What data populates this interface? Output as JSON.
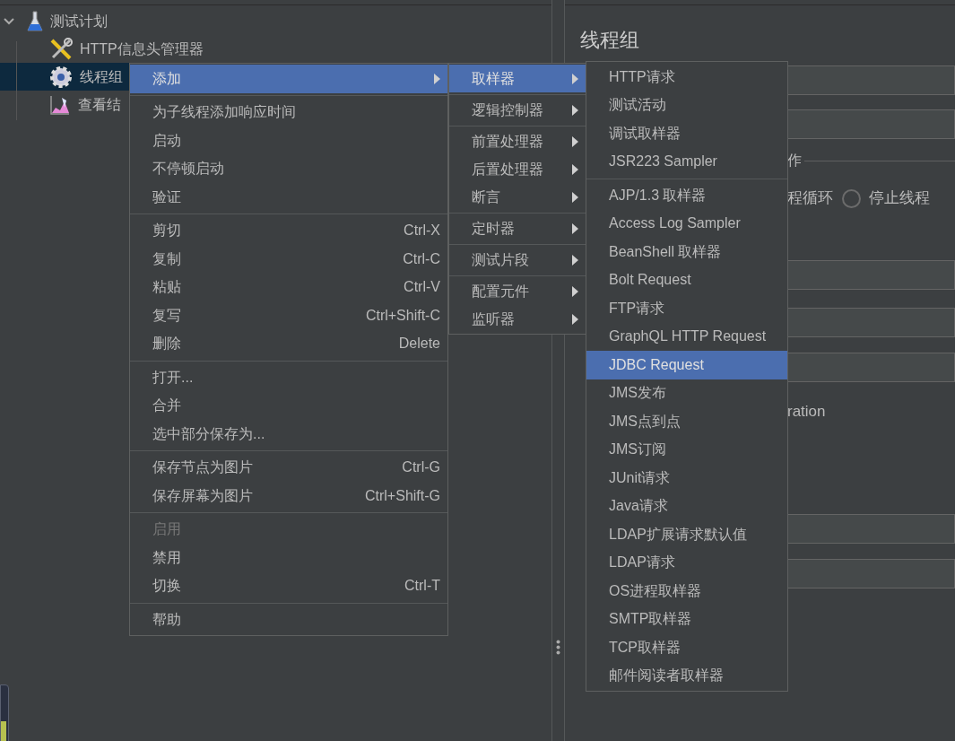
{
  "tree": {
    "label": "测试计划",
    "expanded": true,
    "children": [
      {
        "label": "HTTP信息头管理器",
        "selected": false,
        "kind": "config"
      },
      {
        "label": "线程组",
        "selected": true,
        "kind": "threads"
      },
      {
        "label": "查看结",
        "selected": false,
        "kind": "listener"
      }
    ]
  },
  "right_panel": {
    "title": "线程组",
    "group_label": "作",
    "options": [
      {
        "label": "程循环"
      },
      {
        "label": "停止线程",
        "selected": false
      }
    ],
    "text_1": "ration"
  },
  "context_menu": {
    "items": [
      {
        "kind": "item",
        "label": "添加",
        "submenu": true,
        "selected": true,
        "disabled": false
      },
      {
        "kind": "separator"
      },
      {
        "kind": "item",
        "label": "为子线程添加响应时间",
        "selected": false,
        "disabled": false
      },
      {
        "kind": "item",
        "label": "启动",
        "selected": false,
        "disabled": false
      },
      {
        "kind": "item",
        "label": "不停顿启动",
        "selected": false,
        "disabled": false
      },
      {
        "kind": "item",
        "label": "验证",
        "selected": false,
        "disabled": false
      },
      {
        "kind": "separator"
      },
      {
        "kind": "item",
        "label": "剪切",
        "shortcut": "Ctrl-X",
        "selected": false,
        "disabled": false
      },
      {
        "kind": "item",
        "label": "复制",
        "shortcut": "Ctrl-C",
        "selected": false,
        "disabled": false
      },
      {
        "kind": "item",
        "label": "粘贴",
        "shortcut": "Ctrl-V",
        "selected": false,
        "disabled": false
      },
      {
        "kind": "item",
        "label": "复写",
        "shortcut": "Ctrl+Shift-C",
        "selected": false,
        "disabled": false
      },
      {
        "kind": "item",
        "label": "删除",
        "shortcut": "Delete",
        "selected": false,
        "disabled": false
      },
      {
        "kind": "separator"
      },
      {
        "kind": "item",
        "label": "打开...",
        "selected": false,
        "disabled": false
      },
      {
        "kind": "item",
        "label": "合并",
        "selected": false,
        "disabled": false
      },
      {
        "kind": "item",
        "label": "选中部分保存为...",
        "selected": false,
        "disabled": false
      },
      {
        "kind": "separator"
      },
      {
        "kind": "item",
        "label": "保存节点为图片",
        "shortcut": "Ctrl-G",
        "selected": false,
        "disabled": false
      },
      {
        "kind": "item",
        "label": "保存屏幕为图片",
        "shortcut": "Ctrl+Shift-G",
        "selected": false,
        "disabled": false
      },
      {
        "kind": "separator"
      },
      {
        "kind": "item",
        "label": "启用",
        "selected": false,
        "disabled": true
      },
      {
        "kind": "item",
        "label": "禁用",
        "selected": false,
        "disabled": false
      },
      {
        "kind": "item",
        "label": "切换",
        "shortcut": "Ctrl-T",
        "selected": false,
        "disabled": false
      },
      {
        "kind": "separator"
      },
      {
        "kind": "item",
        "label": "帮助",
        "selected": false,
        "disabled": false
      }
    ]
  },
  "add_submenu": {
    "items": [
      {
        "kind": "item",
        "label": "取样器",
        "submenu": true,
        "selected": true,
        "disabled": false
      },
      {
        "kind": "separator"
      },
      {
        "kind": "item",
        "label": "逻辑控制器",
        "submenu": true,
        "selected": false,
        "disabled": false
      },
      {
        "kind": "separator"
      },
      {
        "kind": "item",
        "label": "前置处理器",
        "submenu": true,
        "selected": false,
        "disabled": false
      },
      {
        "kind": "item",
        "label": "后置处理器",
        "submenu": true,
        "selected": false,
        "disabled": false
      },
      {
        "kind": "item",
        "label": "断言",
        "submenu": true,
        "selected": false,
        "disabled": false
      },
      {
        "kind": "separator"
      },
      {
        "kind": "item",
        "label": "定时器",
        "submenu": true,
        "selected": false,
        "disabled": false
      },
      {
        "kind": "separator"
      },
      {
        "kind": "item",
        "label": "测试片段",
        "submenu": true,
        "selected": false,
        "disabled": false
      },
      {
        "kind": "separator"
      },
      {
        "kind": "item",
        "label": "配置元件",
        "submenu": true,
        "selected": false,
        "disabled": false
      },
      {
        "kind": "item",
        "label": "监听器",
        "submenu": true,
        "selected": false,
        "disabled": false
      }
    ]
  },
  "sampler_submenu": {
    "items": [
      {
        "kind": "item",
        "label": "HTTP请求",
        "selected": false,
        "disabled": false
      },
      {
        "kind": "item",
        "label": "测试活动",
        "selected": false,
        "disabled": false
      },
      {
        "kind": "item",
        "label": "调试取样器",
        "selected": false,
        "disabled": false
      },
      {
        "kind": "item",
        "label": "JSR223 Sampler",
        "selected": false,
        "disabled": false
      },
      {
        "kind": "separator"
      },
      {
        "kind": "item",
        "label": "AJP/1.3 取样器",
        "selected": false,
        "disabled": false
      },
      {
        "kind": "item",
        "label": "Access Log Sampler",
        "selected": false,
        "disabled": false
      },
      {
        "kind": "item",
        "label": "BeanShell 取样器",
        "selected": false,
        "disabled": false
      },
      {
        "kind": "item",
        "label": "Bolt Request",
        "selected": false,
        "disabled": false
      },
      {
        "kind": "item",
        "label": "FTP请求",
        "selected": false,
        "disabled": false
      },
      {
        "kind": "item",
        "label": "GraphQL HTTP Request",
        "selected": false,
        "disabled": false
      },
      {
        "kind": "item",
        "label": "JDBC Request",
        "selected": true,
        "disabled": false
      },
      {
        "kind": "item",
        "label": "JMS发布",
        "selected": false,
        "disabled": false
      },
      {
        "kind": "item",
        "label": "JMS点到点",
        "selected": false,
        "disabled": false
      },
      {
        "kind": "item",
        "label": "JMS订阅",
        "selected": false,
        "disabled": false
      },
      {
        "kind": "item",
        "label": "JUnit请求",
        "selected": false,
        "disabled": false
      },
      {
        "kind": "item",
        "label": "Java请求",
        "selected": false,
        "disabled": false
      },
      {
        "kind": "item",
        "label": "LDAP扩展请求默认值",
        "selected": false,
        "disabled": false
      },
      {
        "kind": "item",
        "label": "LDAP请求",
        "selected": false,
        "disabled": false
      },
      {
        "kind": "item",
        "label": "OS进程取样器",
        "selected": false,
        "disabled": false
      },
      {
        "kind": "item",
        "label": "SMTP取样器",
        "selected": false,
        "disabled": false
      },
      {
        "kind": "item",
        "label": "TCP取样器",
        "selected": false,
        "disabled": false
      },
      {
        "kind": "item",
        "label": "邮件阅读者取样器",
        "selected": false,
        "disabled": false
      }
    ]
  }
}
